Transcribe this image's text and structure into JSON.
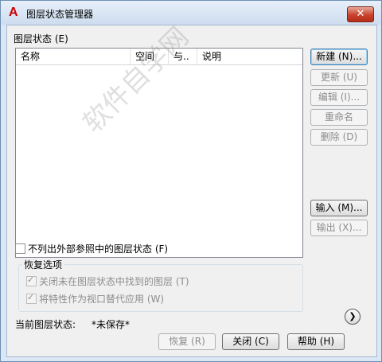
{
  "window": {
    "title": "图层状态管理器",
    "app_logo": "A",
    "close_glyph": "✕"
  },
  "layer_states_label": "图层状态 (E)",
  "list": {
    "columns": [
      "名称",
      "空间",
      "与..",
      "说明"
    ],
    "rows": []
  },
  "buttons": {
    "new": "新建 (N)...",
    "update": "更新 (U)",
    "edit": "编辑 (I)...",
    "rename": "重命名",
    "delete": "删除 (D)",
    "import": "输入 (M)...",
    "export": "输出 (X)...",
    "restore": "恢复 (R)",
    "close": "关闭 (C)",
    "help": "帮助 (H)",
    "expand": "❯"
  },
  "options": {
    "no_xref_label": "不列出外部参照中的图层状态 (F)",
    "restore_group_title": "恢复选项",
    "turn_off_label": "关闭未在图层状态中找到的图层 (T)",
    "viewport_label": "将特性作为视口替代应用 (W)"
  },
  "current_state": {
    "label": "当前图层状态:",
    "value": "*未保存*"
  },
  "watermark": "软件自学网",
  "colors": {
    "title_bg": "#dbe7f5",
    "close_red": "#c8422c",
    "logo_red": "#cc0000"
  }
}
